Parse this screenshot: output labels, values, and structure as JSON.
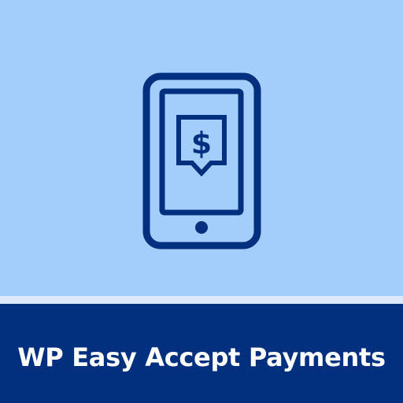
{
  "title": "WP Easy Accept Payments",
  "icons": {
    "main": "mobile-payment-icon",
    "symbol": "dollar-icon"
  },
  "colors": {
    "background": "#a3cdfb",
    "divider": "#dde9fb",
    "footer": "#02307f",
    "icon_stroke": "#02307f",
    "title_text": "#ffffff"
  }
}
